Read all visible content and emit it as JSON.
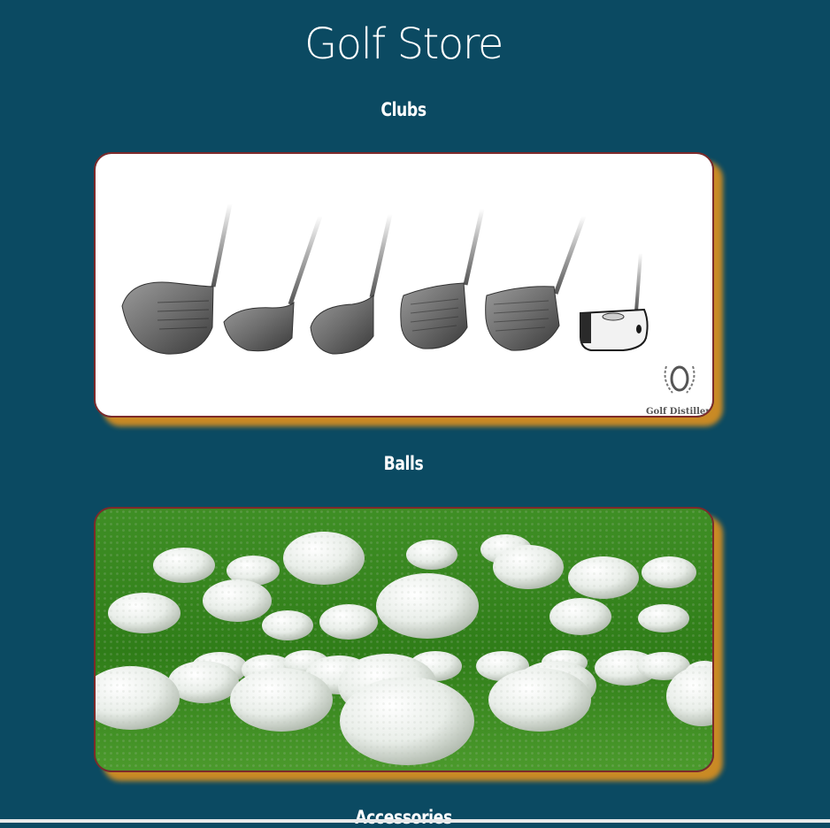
{
  "page": {
    "title": "Golf Store"
  },
  "sections": [
    {
      "heading": "Clubs",
      "image": "golf-clubs-image",
      "watermark": "Golf Distillery"
    },
    {
      "heading": "Balls",
      "image": "golf-balls-image"
    },
    {
      "heading": "Accessories"
    }
  ],
  "colors": {
    "background": "#0b4a62",
    "card_border": "#7d2a2a",
    "card_shadow": "#c98a25",
    "text": "#ffffff",
    "grass": "#3a8a22"
  }
}
